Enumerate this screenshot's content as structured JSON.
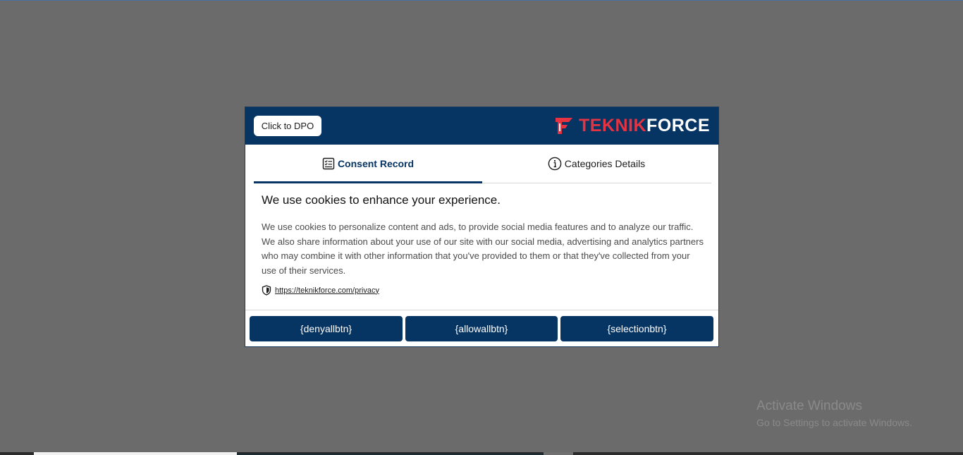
{
  "dialog": {
    "dpo_button_label": "Click to DPO",
    "logo": {
      "part1": "TEKNIK",
      "part2": "FORCE",
      "mark_color": "#e63342",
      "icon": "teknikforce-logo-icon"
    },
    "tabs": [
      {
        "label": "Consent Record",
        "icon": "checklist-icon",
        "active": true
      },
      {
        "label": "Categories Details",
        "icon": "info-icon",
        "active": false
      }
    ],
    "heading": "We use cookies to enhance your experience.",
    "body": "We use cookies to personalize content and ads, to provide social media features and to analyze our traffic. We also share information about your use of our site with our social media, advertising and analytics partners who may combine it with other information that you've provided to them or that they've collected from your use of their services.",
    "privacy_link": "https://teknikforce.com/privacy",
    "privacy_icon": "shield-icon",
    "buttons": {
      "deny": "{denyallbtn}",
      "allow": "{allowallbtn}",
      "selection": "{selectionbtn}"
    }
  },
  "watermark": {
    "title": "Activate Windows",
    "subtitle": "Go to Settings to activate Windows."
  },
  "colors": {
    "header_bg": "#063463",
    "overlay": "#6b6b6b",
    "accent_red": "#e63342"
  }
}
